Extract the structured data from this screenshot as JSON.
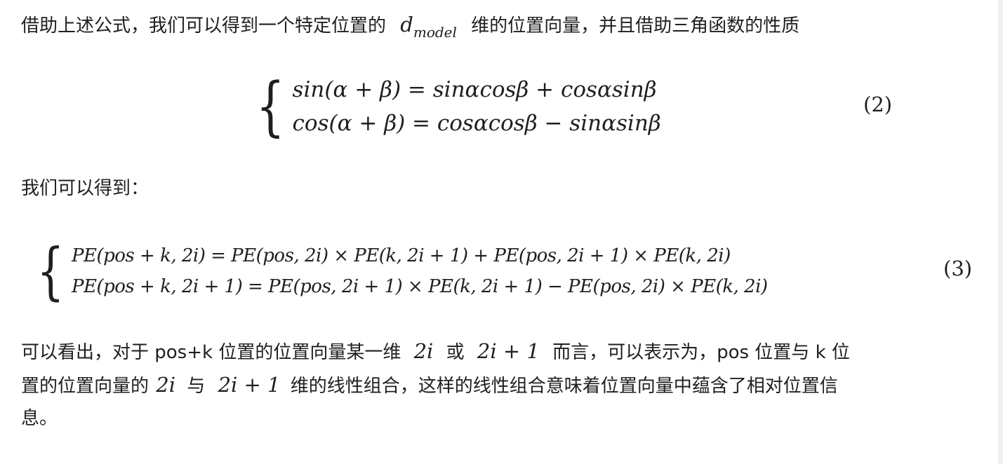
{
  "para1": {
    "text_before": "借助上述公式，我们可以得到一个特定位置的",
    "math_base": "d",
    "math_sub": "model",
    "text_after": "维的位置向量，并且借助三角函数的性质"
  },
  "equation2": {
    "line1": "sin(α + β) = sinαcosβ + cosαsinβ",
    "line2": "cos(α + β) = cosαcosβ − sinαsinβ",
    "number": "(2)"
  },
  "para2": {
    "text": "我们可以得到："
  },
  "equation3": {
    "line1": "PE(pos + k, 2i) = PE(pos, 2i) × PE(k, 2i + 1) + PE(pos, 2i + 1) × PE(k, 2i)",
    "line2": "PE(pos + k, 2i + 1) = PE(pos, 2i + 1) × PE(k, 2i + 1) − PE(pos, 2i) × PE(k, 2i)",
    "number": "(3)"
  },
  "para3": {
    "line1_a": "可以看出，对于 pos+k 位置的位置向量某一维",
    "line1_m1": "2i",
    "line1_b": "或",
    "line1_m2": "2i + 1",
    "line1_c": "而言，可以表示为，pos 位置与 k 位",
    "line2_a": "置的位置向量的",
    "line2_m1": "2i",
    "line2_b": "与",
    "line2_m2": "2i + 1",
    "line2_c": "维的线性组合，这样的线性组合意味着位置向量中蕴含了相对位置信",
    "line3": "息。"
  }
}
